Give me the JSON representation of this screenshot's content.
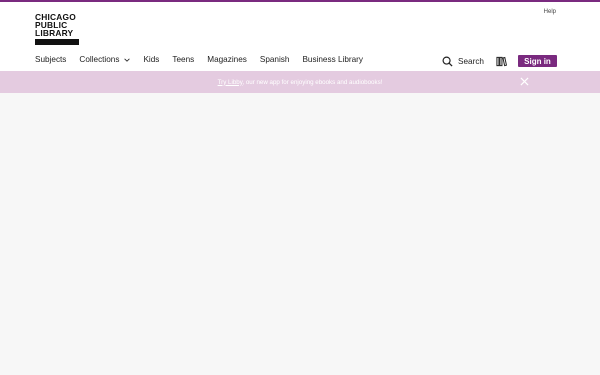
{
  "brand": {
    "logo_text": "CHICAGO\nPUBLIC\nLIBRARY",
    "accent_color": "#7a2a7f",
    "banner_color": "#e4cbe0"
  },
  "header": {
    "help_label": "Help"
  },
  "nav": {
    "items": [
      {
        "label": "Subjects"
      },
      {
        "label": "Collections"
      },
      {
        "label": "Kids"
      },
      {
        "label": "Teens"
      },
      {
        "label": "Magazines"
      },
      {
        "label": "Spanish"
      },
      {
        "label": "Business Library"
      }
    ]
  },
  "tools": {
    "search_label": "Search",
    "search_icon": "search-icon",
    "shelf_icon": "bookshelf-icon",
    "signin_label": "Sign in"
  },
  "banner": {
    "link_text": "Try Libby",
    "text": ", our new app for enjoying ebooks and audiobooks!",
    "close_icon": "close-icon"
  }
}
